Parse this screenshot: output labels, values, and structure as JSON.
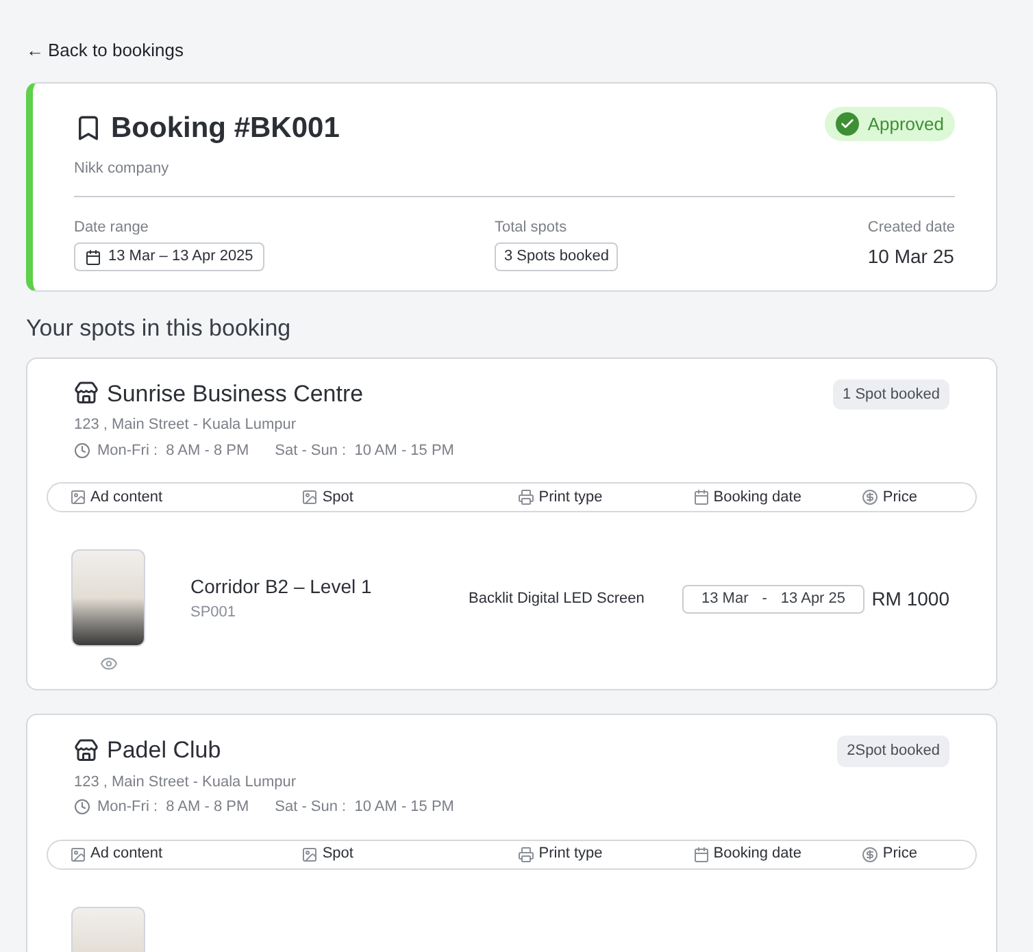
{
  "back_link": {
    "arrow": "←",
    "label": "Back to bookings"
  },
  "booking": {
    "title": "Booking #BK001",
    "company": "Nikk company",
    "status": "Approved",
    "approved": true,
    "date_range": {
      "label": "Date range",
      "value": "13 Mar – 13 Apr 2025"
    },
    "total_spots": {
      "label": "Total spots",
      "value": "3 Spots booked"
    },
    "created_date": {
      "label": "Created date",
      "value": "10 Mar 25"
    }
  },
  "section_title": "Your spots in this booking",
  "venues": [
    {
      "name": "Sunrise Business Centre",
      "badge": "1 Spot booked",
      "address": "123 , Main Street  - Kuala Lumpur",
      "weekday_hours": "Mon-Fri :  8 AM - 8 PM",
      "weekend_hours": "Sat - Sun :  10 AM - 15 PM",
      "columns": [
        "Ad content",
        "Spot",
        "Print type",
        "Booking date",
        "Price"
      ],
      "rows": [
        {
          "kind": "full",
          "spot": "Corridor B2 – Level 1",
          "spot_id": "SP001",
          "print_type": "Backlit Digital LED Screen",
          "start": "13 Mar",
          "separator": "-",
          "end": "13 Apr 25",
          "price": "RM 1000"
        }
      ]
    },
    {
      "name": "Padel Club",
      "badge": "2Spot booked",
      "address": "123 , Main Street  - Kuala Lumpur",
      "weekday_hours": "Mon-Fri :  8 AM - 8 PM",
      "weekend_hours": "Sat - Sun :  10 AM - 15 PM",
      "columns": [
        "Ad content",
        "Spot",
        "Print type",
        "Booking date",
        "Price"
      ],
      "rows": [
        {
          "kind": "cut"
        }
      ]
    }
  ]
}
